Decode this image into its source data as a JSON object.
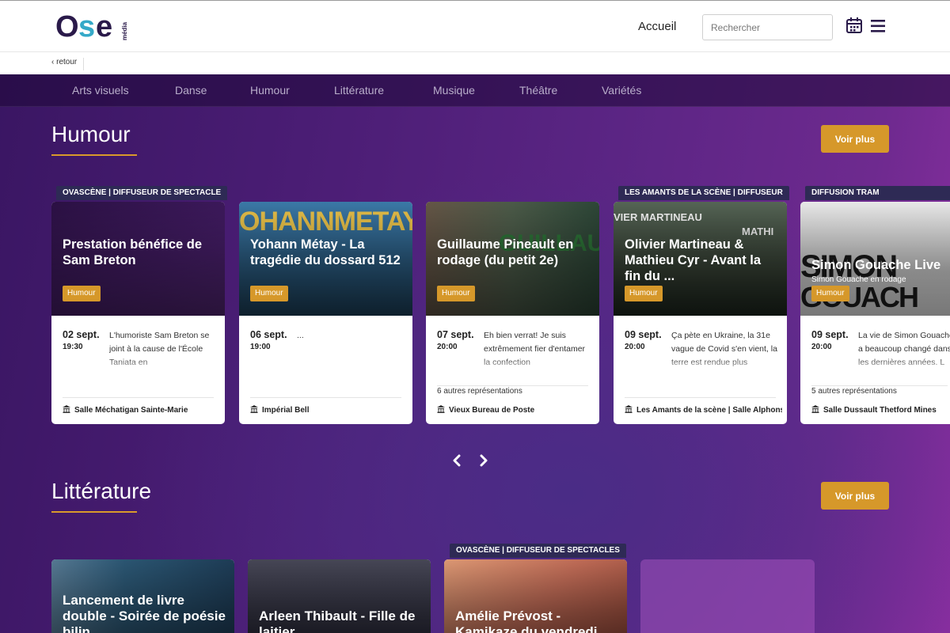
{
  "header": {
    "logo_text": "Ose",
    "logo_sub": "média",
    "nav_home": "Accueil",
    "search_placeholder": "Rechercher",
    "icons": [
      "calendar-icon",
      "hamburger-menu-icon"
    ]
  },
  "breadcrumb": {
    "back": "‹ retour"
  },
  "categories": [
    "Arts visuels",
    "Danse",
    "Humour",
    "Littérature",
    "Musique",
    "Théâtre",
    "Variétés"
  ],
  "sections": [
    {
      "title": "Humour",
      "button": "Voir plus",
      "cards": [
        {
          "presenter": "OVASCÈNE | DIFFUSEUR DE SPECTACLE",
          "title": "Prestation bénéfice de Sam Breton",
          "subtitle": "",
          "genre": "Humour",
          "date": "02 sept.",
          "time": "19:30",
          "desc": "L'humoriste Sam Breton se joint à la cause de l'École Taniata en",
          "more": "",
          "venue": "Salle Méchatigan Sainte-Marie",
          "bg": "#3c1c5c"
        },
        {
          "presenter": "",
          "title": "Yohann Métay - La tragédie du dossard 512",
          "subtitle": "",
          "genre": "Humour",
          "date": "06 sept.",
          "time": "19:00",
          "desc": "...",
          "more": "",
          "venue": "Impérial Bell",
          "bg": "#2f5f8a"
        },
        {
          "presenter": "",
          "title": "Guillaume Pineault en rodage (du petit 2e)",
          "subtitle": "",
          "genre": "Humour",
          "date": "07 sept.",
          "time": "20:00",
          "desc": "Eh bien verrat! Je suis extrêmement fier d'entamer la confection",
          "more": "6 autres représentations",
          "venue": "Vieux Bureau de Poste",
          "bg": "#4c5c4a"
        },
        {
          "presenter": "LES AMANTS DE LA SCÈNE | DIFFUSEUR",
          "title": "Olivier Martineau & Mathieu Cyr - Avant la fin du ...",
          "subtitle": "",
          "genre": "Humour",
          "date": "09 sept.",
          "time": "20:00",
          "desc": "Ça pète en Ukraine, la 31e vague de Covid s'en vient, la terre est rendue plus",
          "more": "",
          "venue": "Les Amants de la scène | Salle Alphonse",
          "bg": "#3a4238"
        },
        {
          "presenter": "DIFFUSION TRAM",
          "title": "Simon Gouache Live",
          "subtitle": "Simon Gouache en rodage",
          "genre": "Humour",
          "date": "09 sept.",
          "time": "20:00",
          "desc": "La vie de Simon Gouache a beaucoup changé dans les dernières années. L",
          "more": "5 autres représentations",
          "venue": "Salle Dussault Thetford Mines",
          "bg": "#cfcfcf"
        }
      ]
    },
    {
      "title": "Littérature",
      "button": "Voir plus",
      "cards": [
        {
          "presenter": "",
          "title": "Lancement de livre double - Soirée de poésie bilin",
          "bg": "#2d5a78"
        },
        {
          "presenter": "",
          "title": "Arleen Thibault - Fille de laitier",
          "bg": "#3a3a4a"
        },
        {
          "presenter": "OVASCÈNE | DIFFUSEUR DE SPECTACLES",
          "title": "Amélie Prévost - Kamikaze du vendredi",
          "bg": "#b85a3a"
        }
      ]
    }
  ],
  "colors": {
    "accent": "#d6982a",
    "presenter_bg": "#2e2a55",
    "purple_dark": "#3a1663",
    "purple_light": "#8a2ea0"
  }
}
